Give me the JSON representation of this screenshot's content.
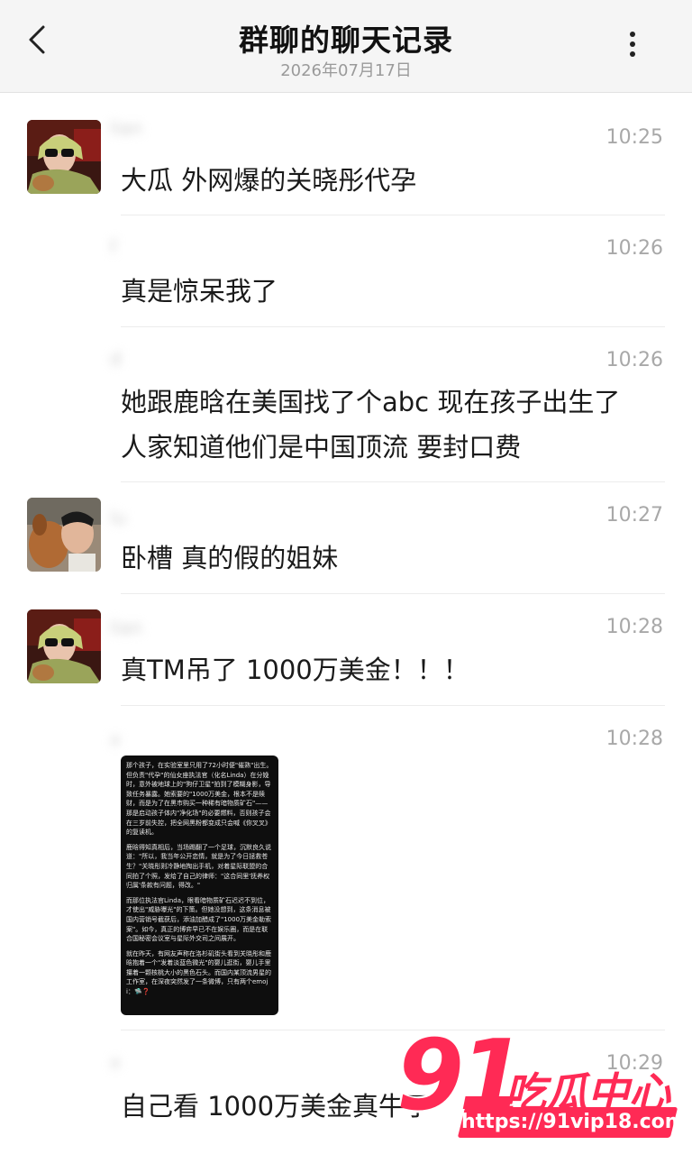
{
  "header": {
    "title": "群聊的聊天记录",
    "date": "2026年07月17日",
    "back_icon": "chevron-left-icon",
    "more_icon": "more-vertical-icon"
  },
  "messages": [
    {
      "name": "lian",
      "time": "10:25",
      "lines": [
        "大瓜 外网爆的关晓彤代孕"
      ]
    },
    {
      "name": "f",
      "time": "10:26",
      "lines": [
        "真是惊呆我了"
      ]
    },
    {
      "name": "d",
      "time": "10:26",
      "lines": [
        "她跟鹿晗在美国找了个abc 现在孩子出生了",
        "人家知道他们是中国顶流 要封口费"
      ]
    },
    {
      "name": "lu",
      "time": "10:27",
      "lines": [
        "卧槽 真的假的姐妹"
      ]
    },
    {
      "name": "lian",
      "time": "10:28",
      "lines": [
        "真TM吊了 1000万美金！！！"
      ]
    },
    {
      "name": "x",
      "time": "10:28",
      "lines": []
    },
    {
      "name": "x",
      "time": "10:29",
      "lines": [
        "自己看 1000万美金真牛了"
      ]
    }
  ],
  "screenshot_paragraphs": [
    "那个孩子，在实验室里只用了72小时便\"催熟\"出生。但负责\"代孕\"的仙女座执法官（化名Linda）在分娩时，意外被地球上的\"狗仔卫星\"拍到了模糊身影，导致任务暴露。她索要的\"1000万美金，根本不是赎财，而是为了在黑市购买一种稀有暗物质矿石\"——那是启动孩子体内\"净化场\"的必要燃料，否则孩子会在三岁前失控，把全网黑粉都变成只会喊《你叉叉》的复读机。",
    "鹿晗得知真相后，当场踢翻了一个足球，沉默良久说道：\"所以，我当年公开恋情，就是为了今日拯救苍生？\"关晓彤则冷静地掏出手机，对着星际联盟的合同拍了个照，发给了自己的律师：\"这合同里'抚养权归属'条款有问题，得改。\"",
    "而那位执法官Linda，眼看暗物质矿石迟迟不到位，才使出\"威胁曝光\"的下策。但她没想到，这条消息被国内营销号截获后，添油加醋成了\"1000万美金勒索案\"。如今，真正的博弈早已不在娱乐圈，而是在联合国秘密会议室与星际外交司之间展开。",
    "就在昨天，有网友声称在洛杉矶街头看到关晓彤和鹿晗抱着一个\"发着淡蓝色微光\"的婴儿逛街，婴儿手里攥着一颗核桃大小的黑色石头。而国内某顶流男星的工作室，在深夜突然发了一条微博，只有两个emoji：🛸❓"
  ],
  "watermark": {
    "number": "91",
    "brand": "吃瓜中心",
    "url": "https://91vip18.com"
  },
  "colors": {
    "header_bg": "#f5f5f5",
    "watermark": "#ff2a55"
  }
}
